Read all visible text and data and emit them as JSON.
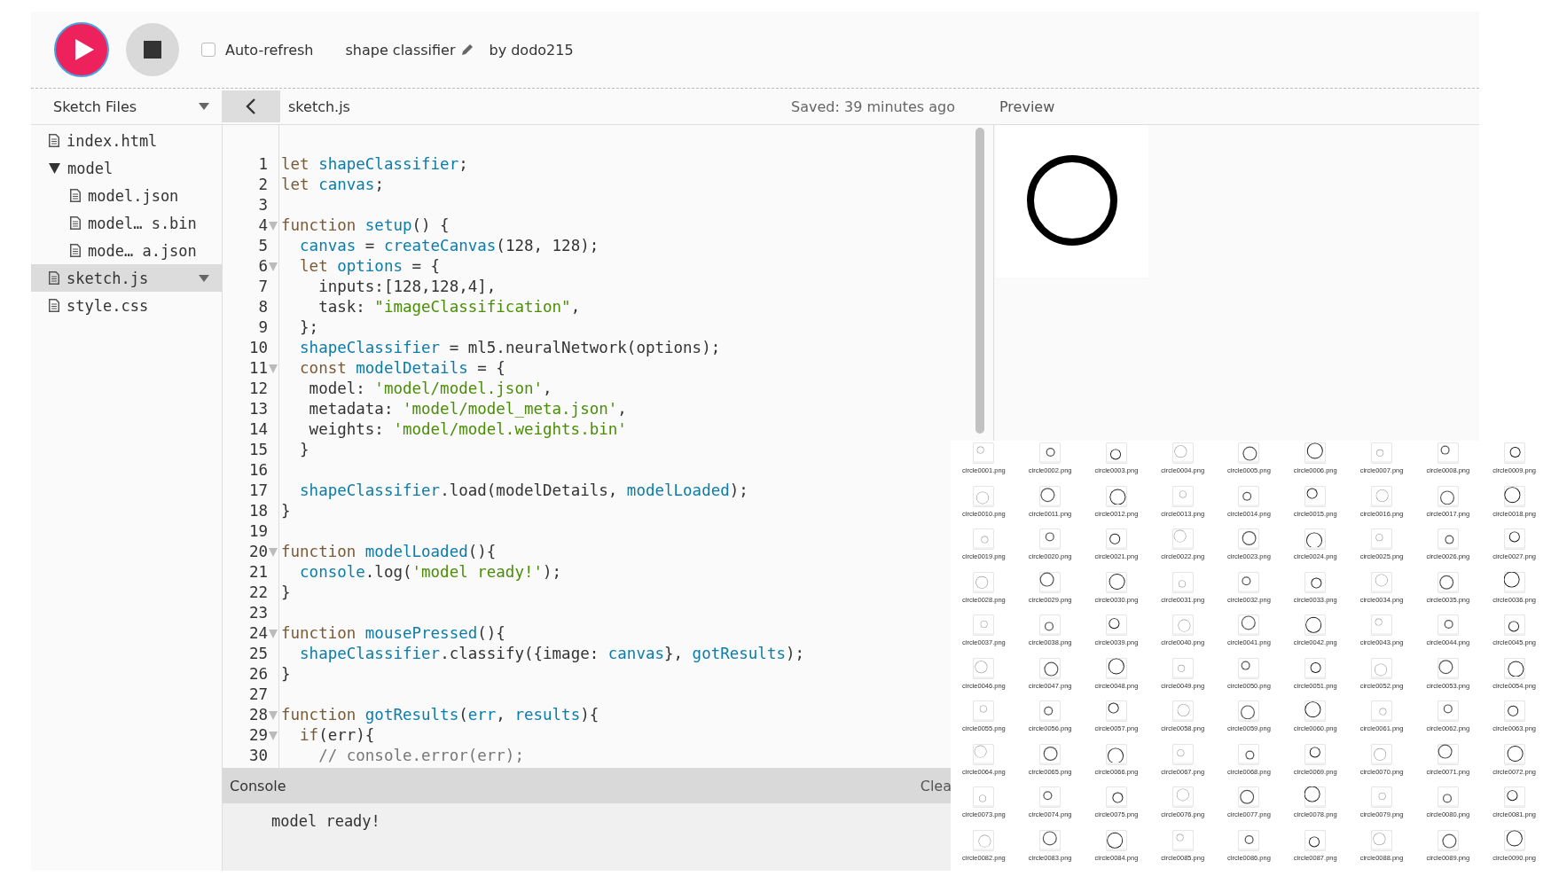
{
  "toolbar": {
    "auto_refresh": {
      "label": "Auto-refresh",
      "checked": false
    },
    "sketch_name": "shape classifier",
    "author": "by dodo215"
  },
  "sidebar": {
    "title": "Sketch Files",
    "items": [
      {
        "kind": "file",
        "name": "index.html",
        "selected": false
      },
      {
        "kind": "folder",
        "name": "model",
        "selected": false,
        "expanded": true,
        "children": [
          {
            "kind": "file",
            "name": "model.json",
            "selected": false
          },
          {
            "kind": "file",
            "name": "model… s.bin",
            "selected": false
          },
          {
            "kind": "file",
            "name": "mode… a.json",
            "selected": false
          }
        ]
      },
      {
        "kind": "file",
        "name": "sketch.js",
        "selected": true
      },
      {
        "kind": "file",
        "name": "style.css",
        "selected": false
      }
    ]
  },
  "editor": {
    "file_name": "sketch.js",
    "saved": "Saved: 39 minutes ago",
    "lines": [
      {
        "number": "1",
        "fold": false,
        "tokens": [
          {
            "kind": "keyword",
            "text": "let "
          },
          {
            "kind": "variable",
            "text": "shapeClassifier"
          },
          {
            "kind": "plain",
            "text": ";"
          }
        ]
      },
      {
        "number": "2",
        "fold": false,
        "tokens": [
          {
            "kind": "keyword",
            "text": "let "
          },
          {
            "kind": "variable",
            "text": "canvas"
          },
          {
            "kind": "plain",
            "text": ";"
          }
        ]
      },
      {
        "number": "3",
        "fold": false
      },
      {
        "number": "4",
        "fold": true,
        "tokens": [
          {
            "kind": "keyword",
            "text": "function "
          },
          {
            "kind": "variable",
            "text": "setup"
          },
          {
            "kind": "plain",
            "text": "() {"
          }
        ]
      },
      {
        "number": "5",
        "fold": false,
        "tokens": [
          {
            "kind": "variable",
            "text": "  canvas"
          },
          {
            "kind": "plain",
            "text": " = "
          },
          {
            "kind": "variable",
            "text": "createCanvas"
          },
          {
            "kind": "plain",
            "text": "(128, 128);"
          }
        ]
      },
      {
        "number": "6",
        "fold": true,
        "tokens": [
          {
            "kind": "keyword",
            "text": "  let "
          },
          {
            "kind": "variable",
            "text": "options"
          },
          {
            "kind": "plain",
            "text": " = {"
          }
        ]
      },
      {
        "number": "7",
        "fold": false,
        "tokens": [
          {
            "kind": "plain",
            "text": "    inputs:[128,128,4],"
          }
        ]
      },
      {
        "number": "8",
        "fold": false,
        "tokens": [
          {
            "kind": "plain",
            "text": "    task: "
          },
          {
            "kind": "string",
            "text": "\"imageClassification\""
          },
          {
            "kind": "plain",
            "text": ","
          }
        ]
      },
      {
        "number": "9",
        "fold": false,
        "tokens": [
          {
            "kind": "plain",
            "text": "  };"
          }
        ]
      },
      {
        "number": "10",
        "fold": false,
        "tokens": [
          {
            "kind": "variable",
            "text": "  shapeClassifier"
          },
          {
            "kind": "plain",
            "text": " = ml5.neuralNetwork(options);"
          }
        ]
      },
      {
        "number": "11",
        "fold": true,
        "tokens": [
          {
            "kind": "keyword",
            "text": "  const "
          },
          {
            "kind": "variable",
            "text": "modelDetails"
          },
          {
            "kind": "plain",
            "text": " = {"
          }
        ]
      },
      {
        "number": "12",
        "fold": false,
        "tokens": [
          {
            "kind": "plain",
            "text": "   model: "
          },
          {
            "kind": "string",
            "text": "'model/model.json'"
          },
          {
            "kind": "plain",
            "text": ","
          }
        ]
      },
      {
        "number": "13",
        "fold": false,
        "tokens": [
          {
            "kind": "plain",
            "text": "   metadata: "
          },
          {
            "kind": "string",
            "text": "'model/model_meta.json'"
          },
          {
            "kind": "plain",
            "text": ","
          }
        ]
      },
      {
        "number": "14",
        "fold": false,
        "tokens": [
          {
            "kind": "plain",
            "text": "   weights: "
          },
          {
            "kind": "string",
            "text": "'model/model.weights.bin'"
          }
        ]
      },
      {
        "number": "15",
        "fold": false,
        "tokens": [
          {
            "kind": "plain",
            "text": "  }"
          }
        ]
      },
      {
        "number": "16",
        "fold": false
      },
      {
        "number": "17",
        "fold": false,
        "tokens": [
          {
            "kind": "variable",
            "text": "  shapeClassifier"
          },
          {
            "kind": "plain",
            "text": ".load(modelDetails, "
          },
          {
            "kind": "variable",
            "text": "modelLoaded"
          },
          {
            "kind": "plain",
            "text": ");"
          }
        ]
      },
      {
        "number": "18",
        "fold": false,
        "tokens": [
          {
            "kind": "plain",
            "text": "}"
          }
        ]
      },
      {
        "number": "19",
        "fold": false
      },
      {
        "number": "20",
        "fold": true,
        "tokens": [
          {
            "kind": "keyword",
            "text": "function "
          },
          {
            "kind": "variable",
            "text": "modelLoaded"
          },
          {
            "kind": "plain",
            "text": "(){"
          }
        ]
      },
      {
        "number": "21",
        "fold": false,
        "tokens": [
          {
            "kind": "variable",
            "text": "  console"
          },
          {
            "kind": "plain",
            "text": ".log("
          },
          {
            "kind": "string",
            "text": "'model ready!'"
          },
          {
            "kind": "plain",
            "text": ");"
          }
        ]
      },
      {
        "number": "22",
        "fold": false,
        "tokens": [
          {
            "kind": "plain",
            "text": "}"
          }
        ]
      },
      {
        "number": "23",
        "fold": false
      },
      {
        "number": "24",
        "fold": true,
        "tokens": [
          {
            "kind": "keyword",
            "text": "function "
          },
          {
            "kind": "variable",
            "text": "mousePressed"
          },
          {
            "kind": "plain",
            "text": "(){"
          }
        ]
      },
      {
        "number": "25",
        "fold": false,
        "tokens": [
          {
            "kind": "variable",
            "text": "  shapeClassifier"
          },
          {
            "kind": "plain",
            "text": ".classify({image: "
          },
          {
            "kind": "variable",
            "text": "canvas"
          },
          {
            "kind": "plain",
            "text": "}, "
          },
          {
            "kind": "variable",
            "text": "gotResults"
          },
          {
            "kind": "plain",
            "text": ");"
          }
        ]
      },
      {
        "number": "26",
        "fold": false,
        "tokens": [
          {
            "kind": "plain",
            "text": "}"
          }
        ]
      },
      {
        "number": "27",
        "fold": false
      },
      {
        "number": "28",
        "fold": true,
        "tokens": [
          {
            "kind": "keyword",
            "text": "function "
          },
          {
            "kind": "variable",
            "text": "gotResults"
          },
          {
            "kind": "plain",
            "text": "("
          },
          {
            "kind": "variable",
            "text": "err"
          },
          {
            "kind": "plain",
            "text": ", "
          },
          {
            "kind": "variable",
            "text": "results"
          },
          {
            "kind": "plain",
            "text": "){"
          }
        ]
      },
      {
        "number": "29",
        "fold": true,
        "tokens": [
          {
            "kind": "keyword",
            "text": "  if"
          },
          {
            "kind": "plain",
            "text": "(err){"
          }
        ]
      },
      {
        "number": "30",
        "fold": false,
        "tokens": [
          {
            "kind": "comment",
            "text": "    // console.error(err);"
          }
        ]
      }
    ]
  },
  "console": {
    "title": "Console",
    "clear": "Clea",
    "messages": [
      "model ready!"
    ]
  },
  "preview": {
    "title": "Preview"
  },
  "file_browser": {
    "files": [
      "circle0001.png",
      "circle0002.png",
      "circle0003.png",
      "circle0004.png",
      "circle0005.png",
      "circle0006.png",
      "circle0007.png",
      "circle0008.png",
      "circle0009.png",
      "circle0010.png",
      "circle0011.png",
      "circle0012.png",
      "circle0013.png",
      "circle0014.png",
      "circle0015.png",
      "circle0016.png",
      "circle0017.png",
      "circle0018.png",
      "circle0019.png",
      "circle0020.png",
      "circle0021.png",
      "circle0022.png",
      "circle0023.png",
      "circle0024.png",
      "circle0025.png",
      "circle0026.png",
      "circle0027.png",
      "circle0028.png",
      "circle0029.png",
      "circle0030.png",
      "circle0031.png",
      "circle0032.png",
      "circle0033.png",
      "circle0034.png",
      "circle0035.png",
      "circle0036.png",
      "circle0037.png",
      "circle0038.png",
      "circle0039.png",
      "circle0040.png",
      "circle0041.png",
      "circle0042.png",
      "circle0043.png",
      "circle0044.png",
      "circle0045.png",
      "circle0046.png",
      "circle0047.png",
      "circle0048.png",
      "circle0049.png",
      "circle0050.png",
      "circle0051.png",
      "circle0052.png",
      "circle0053.png",
      "circle0054.png",
      "circle0055.png",
      "circle0056.png",
      "circle0057.png",
      "circle0058.png",
      "circle0059.png",
      "circle0060.png",
      "circle0061.png",
      "circle0062.png",
      "circle0063.png",
      "circle0064.png",
      "circle0065.png",
      "circle0066.png",
      "circle0067.png",
      "circle0068.png",
      "circle0069.png",
      "circle0070.png",
      "circle0071.png",
      "circle0072.png",
      "circle0073.png",
      "circle0074.png",
      "circle0075.png",
      "circle0076.png",
      "circle0077.png",
      "circle0078.png",
      "circle0079.png",
      "circle0080.png",
      "circle0081.png",
      "circle0082.png",
      "circle0083.png",
      "circle0084.png",
      "circle0085.png",
      "circle0086.png",
      "circle0087.png",
      "circle0088.png",
      "circle0089.png",
      "circle0090.png"
    ]
  }
}
